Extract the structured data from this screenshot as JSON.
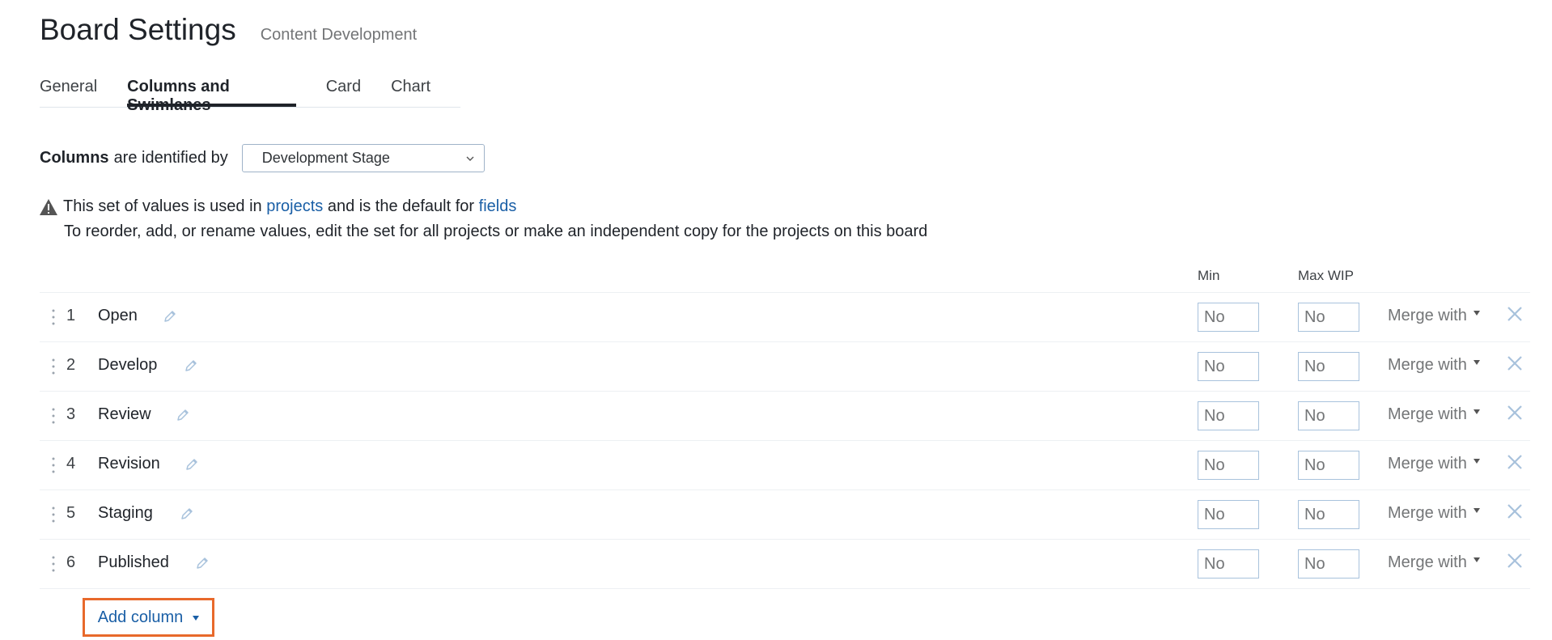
{
  "header": {
    "title": "Board Settings",
    "subtitle": "Content Development"
  },
  "tabs": [
    {
      "label": "General",
      "active": false
    },
    {
      "label": "Columns and Swimlanes",
      "active": true
    },
    {
      "label": "Card",
      "active": false
    },
    {
      "label": "Chart",
      "active": false
    }
  ],
  "identify": {
    "bold": "Columns",
    "rest": "are identified by",
    "selected": "Development Stage"
  },
  "notice": {
    "part1": "This set of values is used in",
    "link1": "projects",
    "part2": "and is the default for",
    "link2": "fields",
    "line2": "To reorder, add, or rename values, edit the set for all projects or make an independent copy for the projects on this board"
  },
  "table": {
    "min_header": "Min",
    "max_header": "Max WIP",
    "merge_label": "Merge with",
    "rows": [
      {
        "num": "1",
        "name": "Open",
        "min": "No",
        "max": "No"
      },
      {
        "num": "2",
        "name": "Develop",
        "min": "No",
        "max": "No"
      },
      {
        "num": "3",
        "name": "Review",
        "min": "No",
        "max": "No"
      },
      {
        "num": "4",
        "name": "Revision",
        "min": "No",
        "max": "No"
      },
      {
        "num": "5",
        "name": "Staging",
        "min": "No",
        "max": "No"
      },
      {
        "num": "6",
        "name": "Published",
        "min": "No",
        "max": "No"
      }
    ]
  },
  "add_column_label": "Add column",
  "colors": {
    "link": "#1a5fa6",
    "highlight": "#e8692b",
    "icon": "#a8c2dc"
  },
  "icons": {
    "warning": "warning-icon",
    "edit": "pencil-icon",
    "drag": "drag-handle-icon",
    "remove": "close-icon",
    "dropdown": "caret-down-icon"
  }
}
